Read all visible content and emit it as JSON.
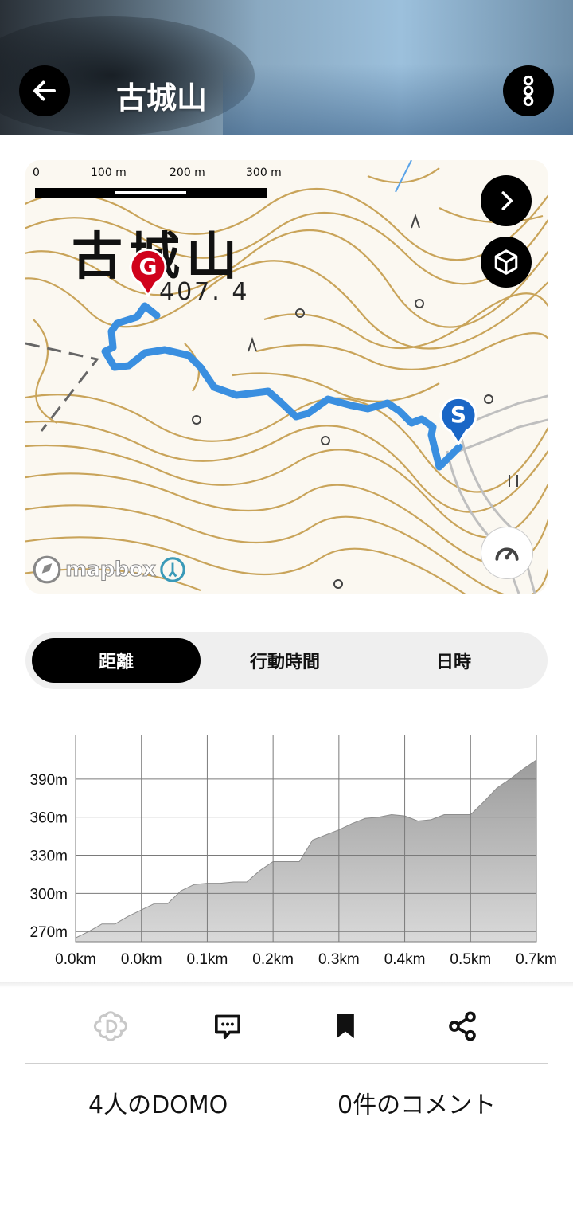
{
  "header": {
    "title": "古城山",
    "back_icon": "arrow-left-icon",
    "menu_icon": "more-vertical-icon"
  },
  "map": {
    "scale_labels": [
      "0",
      "100 m",
      "200 m",
      "300 m"
    ],
    "place_name": "古城山",
    "elevation_label": "407. 4",
    "goal_marker": "G",
    "start_marker": "S",
    "attribution": "mapbox",
    "route_color": "#3a8fe0",
    "contour_color": "#c9a45a",
    "goal_color": "#d0021b",
    "start_color": "#1a66c6"
  },
  "segment": {
    "items": [
      "距離",
      "行動時間",
      "日時"
    ],
    "active": "距離"
  },
  "chart_data": {
    "type": "area",
    "title": "",
    "xlabel": "",
    "ylabel": "",
    "x_tick_labels": [
      "0.0km",
      "0.0km",
      "0.1km",
      "0.2km",
      "0.3km",
      "0.4km",
      "0.5km",
      "0.7km"
    ],
    "y_tick_labels": [
      "270m",
      "300m",
      "330m",
      "360m",
      "390m"
    ],
    "ylim": [
      262,
      425
    ],
    "xlim": [
      0,
      0.7
    ],
    "grid": true,
    "x": [
      0,
      0.02,
      0.04,
      0.06,
      0.08,
      0.1,
      0.12,
      0.14,
      0.16,
      0.18,
      0.2,
      0.22,
      0.24,
      0.26,
      0.28,
      0.3,
      0.32,
      0.34,
      0.36,
      0.38,
      0.4,
      0.42,
      0.44,
      0.46,
      0.48,
      0.5,
      0.52,
      0.54,
      0.56,
      0.58,
      0.6,
      0.62,
      0.64,
      0.66,
      0.68,
      0.7
    ],
    "y": [
      265,
      270,
      276,
      276,
      282,
      287,
      292,
      292,
      302,
      307,
      308,
      308,
      309,
      309,
      318,
      325,
      325,
      325,
      342,
      346,
      350,
      355,
      359,
      360,
      362,
      361,
      357,
      358,
      362,
      362,
      362,
      372,
      383,
      390,
      398,
      405
    ]
  },
  "actions": {
    "domo_icon": "domo-flower-icon",
    "comment_icon": "comment-bubble-icon",
    "bookmark_icon": "bookmark-icon",
    "share_icon": "share-icon"
  },
  "stats": {
    "domo_text": "4人のDOMO",
    "comment_text": "0件のコメント"
  }
}
